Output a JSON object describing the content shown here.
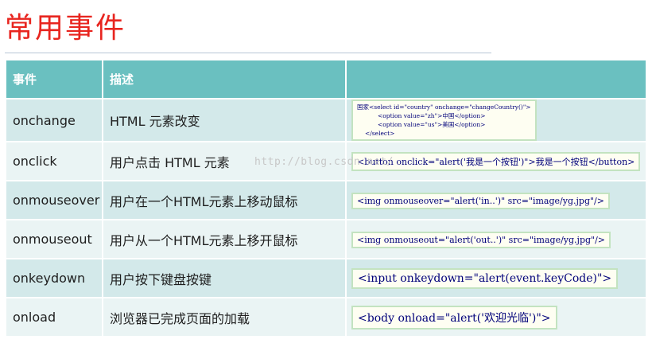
{
  "page": {
    "title": "常用事件"
  },
  "table": {
    "headers": [
      "事件",
      "描述",
      ""
    ],
    "rows": [
      {
        "event": "onchange",
        "desc": "HTML 元素改变",
        "code_lines": [
          "国家<select id=\"country\" onchange=\"changeCountry()\">",
          "<option value=\"zh\">中国</option>",
          "<option value=\"us\">美国</option>",
          "</select>"
        ]
      },
      {
        "event": "onclick",
        "desc": "用户点击 HTML 元素",
        "code": "<button onclick=\"alert('我是一个按钮')\">我是一个按钮</button>"
      },
      {
        "event": "onmouseover",
        "desc": "用户在一个HTML元素上移动鼠标",
        "code": "<img onmouseover=\"alert('in..')\" src=\"image/yg.jpg\"/>"
      },
      {
        "event": "onmouseout",
        "desc": "用户从一个HTML元素上移开鼠标",
        "code": "<img onmouseout=\"alert('out..')\" src=\"image/yg.jpg\"/>"
      },
      {
        "event": "onkeydown",
        "desc": "用户按下键盘按键",
        "code": "<input onkeydown=\"alert(event.keyCode)\">"
      },
      {
        "event": "onload",
        "desc": "浏览器已完成页面的加载",
        "code": "<body onload=\"alert('欢迎光临')\">"
      }
    ]
  },
  "watermark": "http://blog.csdn.net/",
  "colors": {
    "title": "#e8251f",
    "header_bg": "#6ac0c0",
    "row_odd": "#d3e9ea",
    "row_even": "#eaf4f4"
  }
}
